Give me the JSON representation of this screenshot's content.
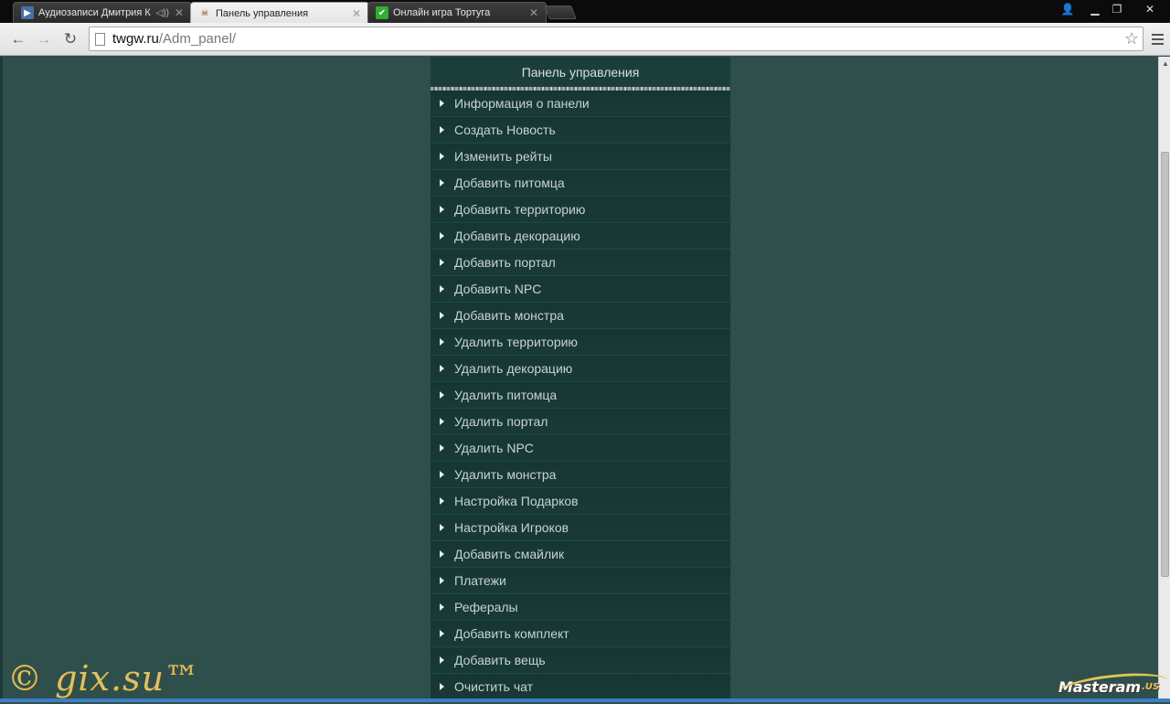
{
  "tabs": [
    {
      "title": "Аудиозаписи Дмитрия К",
      "active": false,
      "favicon": "vk-audio-icon",
      "audio": true
    },
    {
      "title": "Панель управления",
      "active": true,
      "favicon": "pirate-icon",
      "audio": false
    },
    {
      "title": "Онлайн игра Тортуга",
      "active": false,
      "favicon": "checkbox-green-icon",
      "audio": false
    }
  ],
  "window_controls": [
    "user-icon",
    "minimize-icon",
    "restore-icon",
    "close-icon"
  ],
  "toolbar": {
    "url_host": "twgw.ru",
    "url_path": "/Adm_panel/"
  },
  "panel": {
    "title": "Панель управления",
    "items": [
      "Информация о панели",
      "Создать Новость",
      "Изменить рейты",
      "Добавить питомца",
      "Добавить территорию",
      "Добавить декорацию",
      "Добавить портал",
      "Добавить NPC",
      "Добавить монстра",
      "Удалить территорию",
      "Удалить декорацию",
      "Удалить питомца",
      "Удалить портал",
      "Удалить NPC",
      "Удалить монстра",
      "Настройка Подарков",
      "Настройка Игроков",
      "Добавить смайлик",
      "Платежи",
      "Рефералы",
      "Добавить комплект",
      "Добавить вещь",
      "Очистить чат"
    ]
  },
  "watermarks": {
    "left": "© gix.su™",
    "right_main": "Masteram",
    "right_suffix": ".US"
  },
  "colors": {
    "page_bg": "#2f4f4d",
    "panel_bg": "#183a37",
    "menu_text": "#c6d4d2"
  }
}
